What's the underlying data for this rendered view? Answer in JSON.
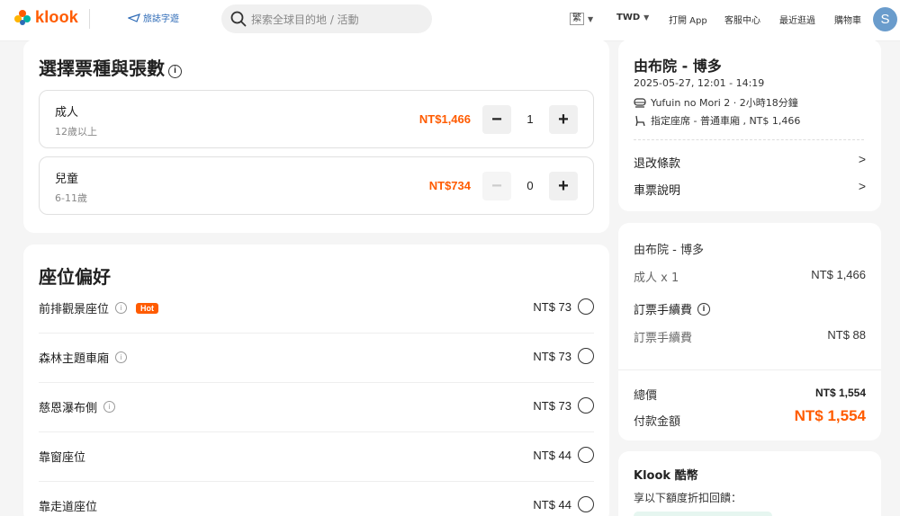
{
  "header": {
    "brand": "klook",
    "partner_label": "旅誌字遊",
    "search_placeholder": "探索全球目的地 / 活動",
    "lang": "繁",
    "currency": "TWD",
    "open_app": "打開 App",
    "help": "客服中心",
    "recent": "最近逛過",
    "cart": "購物車",
    "avatar_letter": "S"
  },
  "tickets": {
    "title": "選擇票種與張數",
    "items": [
      {
        "name": "成人",
        "sub": "12歲以上",
        "price": "NT$1,466",
        "qty": "1"
      },
      {
        "name": "兒童",
        "sub": "6-11歲",
        "price": "NT$734",
        "qty": "0"
      }
    ]
  },
  "seats": {
    "title": "座位偏好",
    "hot_label": "Hot",
    "items": [
      {
        "label": "前排觀景座位",
        "price": "NT$ 73"
      },
      {
        "label": "森林主題車廂",
        "price": "NT$ 73"
      },
      {
        "label": "慈恩瀑布側",
        "price": "NT$ 73"
      },
      {
        "label": "靠窗座位",
        "price": "NT$ 44"
      },
      {
        "label": "靠走道座位",
        "price": "NT$ 44"
      }
    ]
  },
  "trip": {
    "route": "由布院 - 博多",
    "datetime": "2025-05-27, 12:01 - 14:19",
    "train": "Yufuin no Mori 2 · 2小時18分鐘",
    "seat_type": "指定座席 - 普通車廂 , NT$ 1,466",
    "refund_link": "退改條款",
    "info_link": "車票說明"
  },
  "summary": {
    "route": "由布院 - 博多",
    "adult_label": "成人 x 1",
    "adult_price": "NT$ 1,466",
    "fee_title": "訂票手續費",
    "fee_label": "訂票手續費",
    "fee_price": "NT$ 88",
    "total_label": "總價",
    "total_value": "NT$ 1,554",
    "pay_label": "付款金額",
    "pay_value": "NT$ 1,554"
  },
  "coins": {
    "title": "Klook 酷幣",
    "subtitle": "享以下額度折扣回饋："
  },
  "colors": {
    "accent": "#ff5b00"
  }
}
